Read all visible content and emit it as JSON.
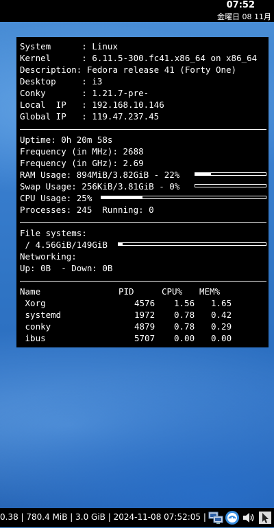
{
  "topbar": {
    "time": "07:52",
    "date": "金曜日 08 11月"
  },
  "conky": {
    "system_label": "System      : Linux",
    "kernel_label": "Kernel      : 6.11.5-300.fc41.x86_64 on x86_64",
    "description": "Description: Fedora release 41 (Forty One)",
    "desktop": "Desktop     : i3",
    "conky_version": "Conky       : 1.21.7-pre-",
    "local_ip": "Local  IP   : 192.168.10.146",
    "global_ip": "Global IP   : 119.47.237.45",
    "uptime": "Uptime: 0h 20m 58s",
    "freq_mhz": "Frequency (in MHz): 2688",
    "freq_ghz": "Frequency (in GHz): 2.69",
    "ram_usage": "RAM Usage: 894MiB/3.82GiB - 22%",
    "ram_percent": 22,
    "swap_usage": "Swap Usage: 256KiB/3.81GiB - 0%",
    "swap_percent": 0,
    "cpu_usage": "CPU Usage: 25%",
    "cpu_percent": 25,
    "processes": "Processes: 245  Running: 0",
    "fs_header": "File systems:",
    "fs_root": " / 4.56GiB/149GiB",
    "fs_percent": 3,
    "net_header": "Networking:",
    "net_speed": "Up: 0B  - Down: 0B",
    "proc_headers": {
      "name": "Name",
      "pid": "PID",
      "cpu": "CPU%",
      "mem": "MEM%"
    },
    "processes_list": [
      {
        "name": " Xorg",
        "pid": "4576",
        "cpu": "1.56",
        "mem": "1.65"
      },
      {
        "name": " systemd",
        "pid": "1972",
        "cpu": "0.78",
        "mem": "0.42"
      },
      {
        "name": " conky",
        "pid": "4879",
        "cpu": "0.78",
        "mem": "0.29"
      },
      {
        "name": " ibus",
        "pid": "5707",
        "cpu": "0.00",
        "mem": "0.00"
      }
    ]
  },
  "statusbar": {
    "text": "0.38 | 780.4 MiB | 3.0 GiB | 2024-11-08 07:52:05 |",
    "tray_icons": [
      "network-icon",
      "input-method-icon",
      "volume-icon",
      "cursor-app-icon"
    ]
  }
}
